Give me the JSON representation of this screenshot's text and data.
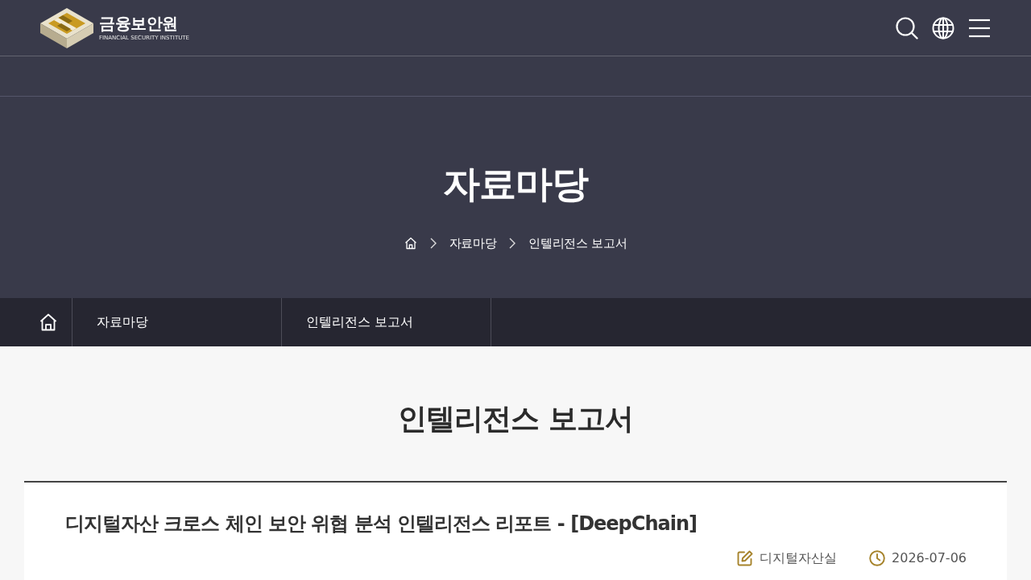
{
  "header": {
    "logo": {
      "name": "금융보안원",
      "tagline": "FINANCIAL SECURITY INSTITUTE"
    }
  },
  "hero": {
    "title": "자료마당",
    "breadcrumb": [
      "자료마당",
      "인텔리전스 보고서"
    ]
  },
  "subnav": {
    "items": [
      {
        "label": "자료마당"
      },
      {
        "label": "인텔리전스 보고서"
      }
    ]
  },
  "page": {
    "heading": "인텔리전스 보고서"
  },
  "article": {
    "title": "디지털자산 크로스 체인 보안 위협 분석 인텔리전스 리포트 - [DeepChain]",
    "department": "디지털자산실",
    "date": "2026-07-06"
  }
}
